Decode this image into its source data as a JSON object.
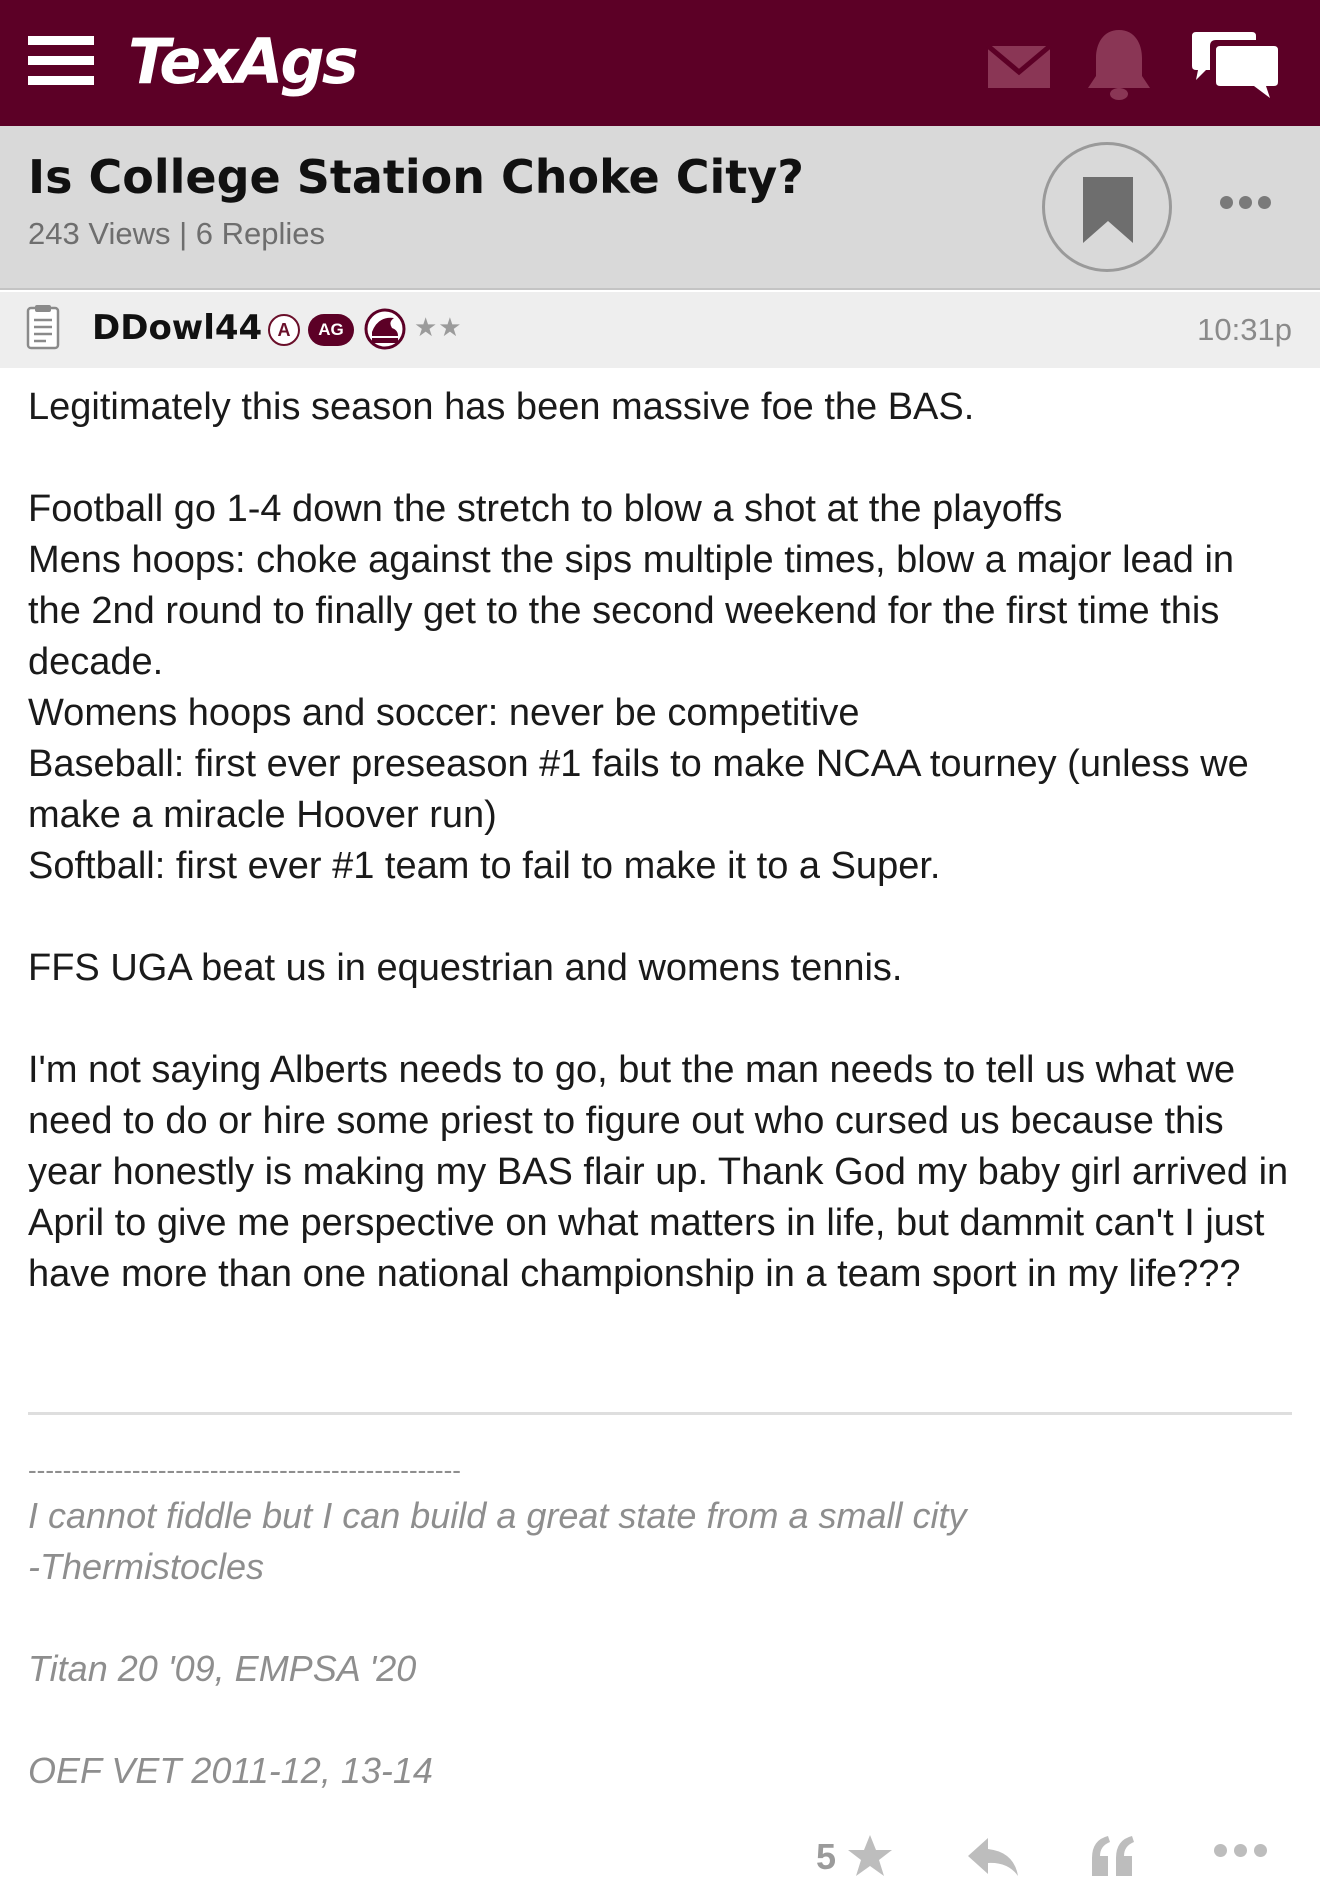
{
  "app": {
    "logo_text": "TexAgs",
    "brand_color": "#5c0026",
    "nav_icons": [
      "hamburger-menu-icon",
      "mail-icon",
      "bell-icon",
      "chat-icon"
    ]
  },
  "thread": {
    "title": "Is College Station Choke City?",
    "stats": "243 Views | 6 Replies"
  },
  "post": {
    "username": "DDowl44",
    "badge_a": "A",
    "badge_ag": "AG",
    "stars": "★★",
    "time": "10:31p",
    "paragraphs": [
      "Legitimately this season has been massive foe the BAS.",
      "Football go 1-4 down the stretch to blow a shot at the playoffs\nMens hoops: choke against the sips multiple times, blow a major lead in the 2nd round to finally get to the second weekend for the first time this decade.\nWomens hoops and soccer: never be competitive\nBaseball: first ever preseason #1 fails to make NCAA tourney (unless we make a miracle Hoover run)\nSoftball: first ever #1 team to fail to make it to a Super.",
      "FFS UGA beat us in equestrian and womens tennis.",
      "I'm not saying Alberts needs to go, but the man needs to tell us what we need to do or hire some priest to figure out who cursed us because this year honestly is making my BAS flair up. Thank God my baby girl arrived in April to give me perspective on what matters in life, but dammit can't I just have more than one national championship in a team sport in my life???"
    ]
  },
  "signature": {
    "separator": "--------------------------------------------------",
    "quote": "I cannot fiddle but I can build a great state from a small city",
    "attribution": "-Thermistocles",
    "line1": "Titan 20 '09, EMPSA '20",
    "line2": "OEF VET 2011-12, 13-14"
  },
  "actions": {
    "rating_count": "5"
  }
}
